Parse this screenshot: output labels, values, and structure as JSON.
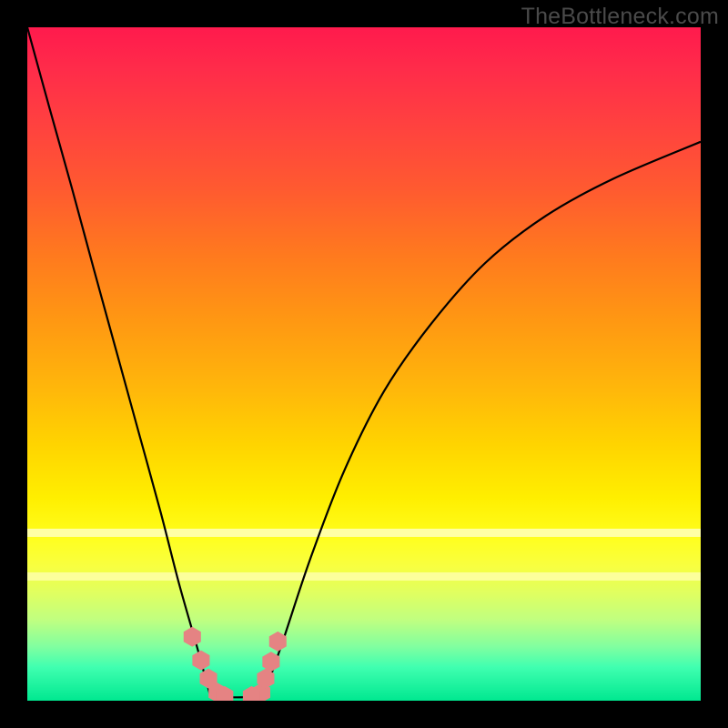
{
  "watermark": "TheBottleneck.com",
  "chart_data": {
    "type": "line",
    "title": "",
    "xlabel": "",
    "ylabel": "",
    "xlim": [
      0,
      1
    ],
    "ylim": [
      0,
      1
    ],
    "grid": false,
    "legend": false,
    "background_gradient": {
      "top": "#ff1a4d",
      "mid": "#ffd400",
      "bottom": "#00e890"
    },
    "series": [
      {
        "name": "left-branch",
        "color": "#000000",
        "x": [
          0.0,
          0.033,
          0.066,
          0.099,
          0.132,
          0.165,
          0.198,
          0.225,
          0.252,
          0.271
        ],
        "y": [
          1.0,
          0.88,
          0.762,
          0.64,
          0.52,
          0.4,
          0.28,
          0.175,
          0.08,
          0.01
        ]
      },
      {
        "name": "right-branch",
        "color": "#000000",
        "x": [
          0.352,
          0.38,
          0.42,
          0.47,
          0.53,
          0.6,
          0.68,
          0.77,
          0.87,
          1.0
        ],
        "y": [
          0.01,
          0.09,
          0.21,
          0.34,
          0.46,
          0.56,
          0.65,
          0.72,
          0.775,
          0.83
        ]
      },
      {
        "name": "floor",
        "color": "#000000",
        "x": [
          0.271,
          0.29,
          0.312,
          0.334,
          0.352
        ],
        "y": [
          0.01,
          0.006,
          0.005,
          0.006,
          0.01
        ]
      },
      {
        "name": "left-markers",
        "color": "#e58383",
        "marker": "hexagon",
        "x": [
          0.245,
          0.258,
          0.269,
          0.282
        ],
        "y": [
          0.095,
          0.06,
          0.033,
          0.012
        ]
      },
      {
        "name": "right-markers",
        "color": "#e58383",
        "marker": "hexagon",
        "x": [
          0.348,
          0.354,
          0.362,
          0.372
        ],
        "y": [
          0.012,
          0.033,
          0.058,
          0.088
        ]
      },
      {
        "name": "floor-left-marker",
        "color": "#e58383",
        "marker": "hexagon",
        "x": [
          0.293
        ],
        "y": [
          0.007
        ]
      },
      {
        "name": "floor-right-marker",
        "color": "#e58383",
        "marker": "hexagon",
        "x": [
          0.333
        ],
        "y": [
          0.007
        ]
      }
    ]
  }
}
